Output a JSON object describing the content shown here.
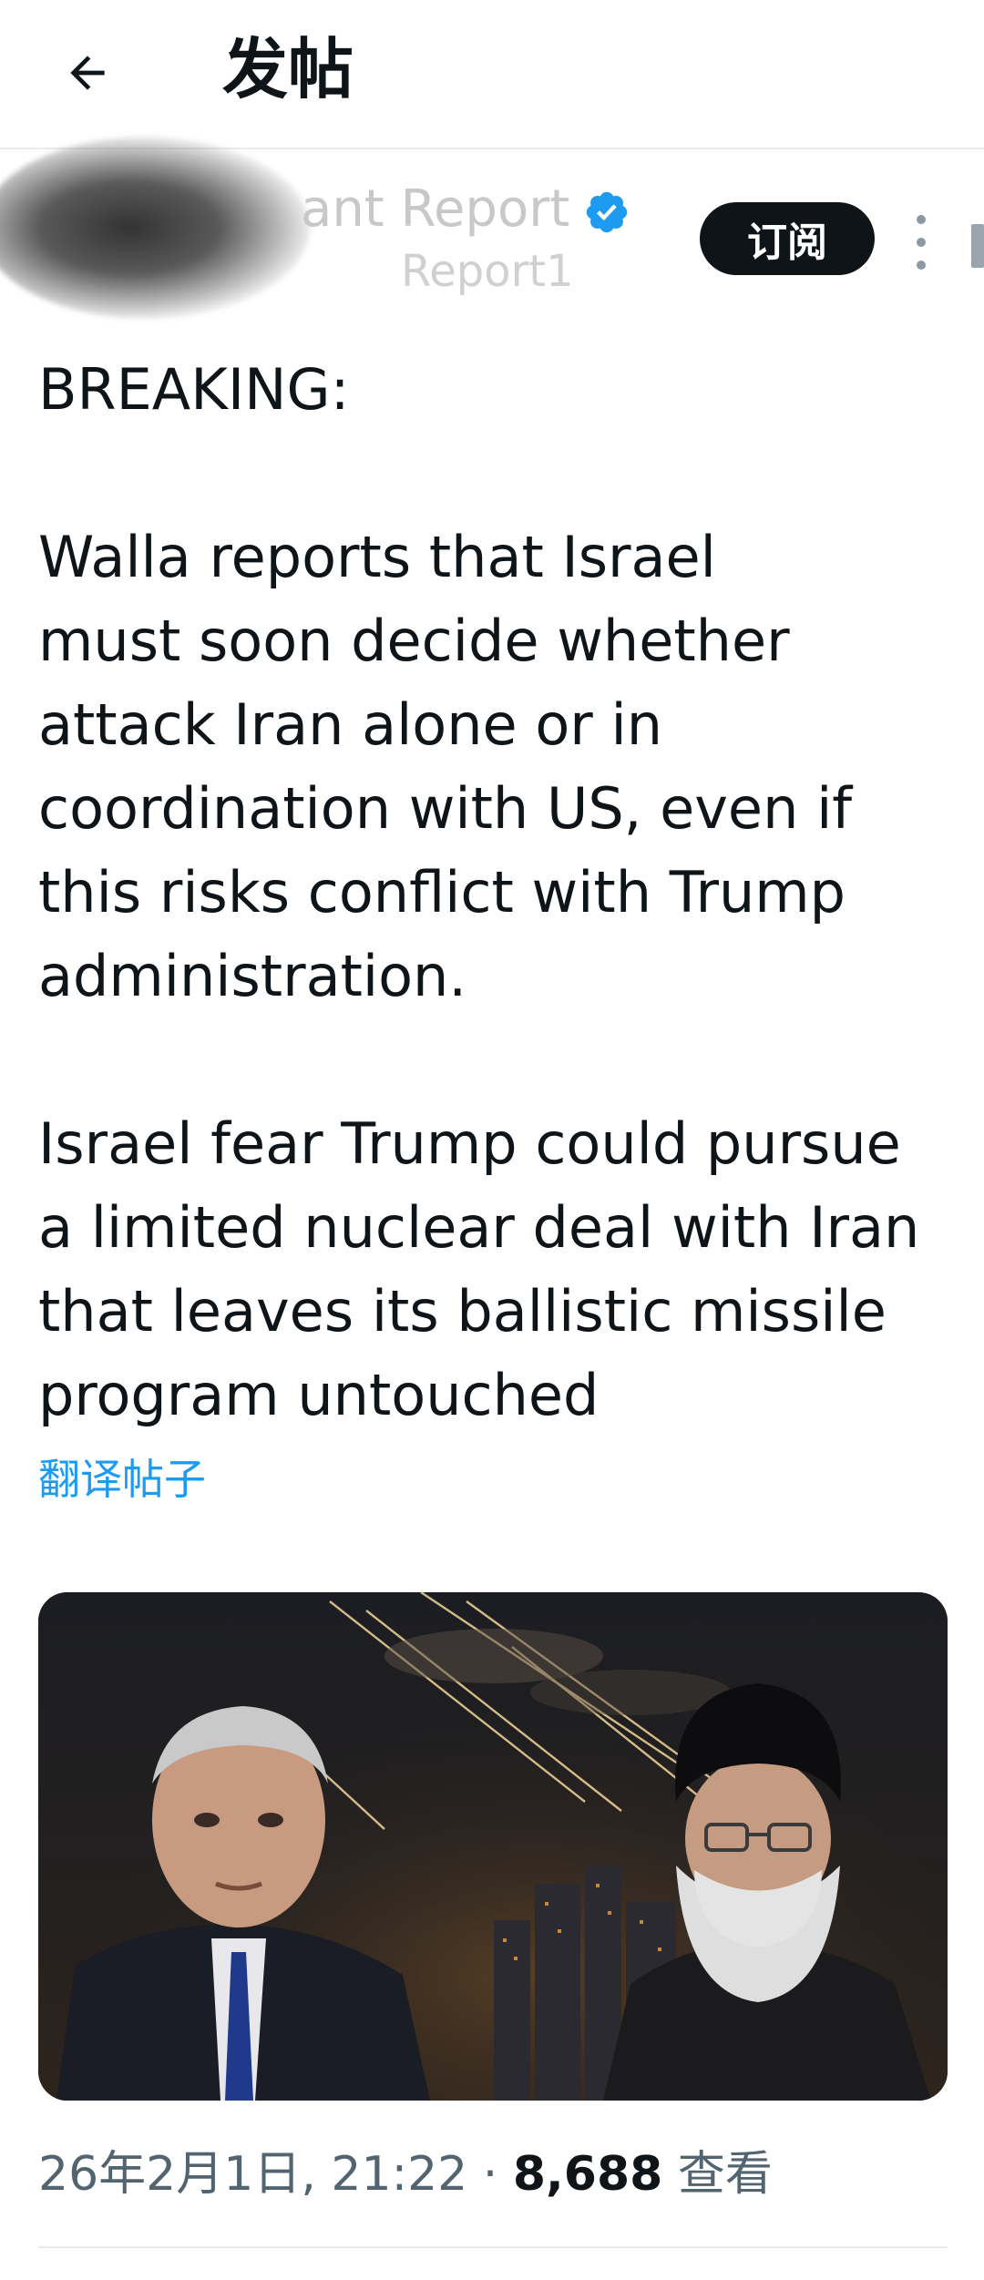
{
  "header": {
    "title": "发帖",
    "back_icon": "arrow-left-icon"
  },
  "author": {
    "name": "ant Report",
    "handle": "Report1",
    "verified_icon": "verified-badge-icon",
    "subscribe_label": "订阅",
    "more_icon": "more-vertical-icon"
  },
  "tweet": {
    "line1": "BREAKING:",
    "para2": "Walla reports that Israel\nmust soon decide whether\nattack Iran alone or in\ncoordination with US, even if\nthis risks conflict with Trump\nadministration.",
    "para3": "Israel fear Trump could pursue\na limited nuclear deal with Iran\nthat leaves its ballistic missile\nprogram untouched",
    "translate_label": "翻译帖子"
  },
  "meta": {
    "datetime": "26年2月1日, 21:22",
    "separator": " · ",
    "views_count": "8,688",
    "views_label": " 查看"
  },
  "colors": {
    "text": "#0f1419",
    "link": "#1d9bf0",
    "muted": "#536471",
    "verified": "#1d9bf0",
    "button_bg": "#0f1419"
  }
}
